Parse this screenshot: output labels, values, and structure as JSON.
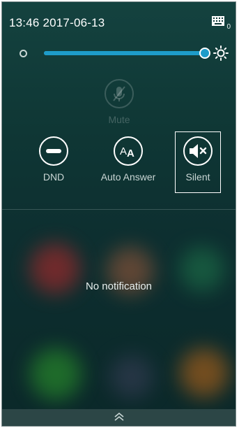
{
  "status_bar": {
    "time_date": "13:46 2017-06-13",
    "icon": "keyboard-icon",
    "badge": "0"
  },
  "brightness": {
    "level_percent": 98,
    "min_icon": "circle-outline-icon",
    "max_icon": "sun-icon"
  },
  "quick_toggles": {
    "mute": {
      "label": "Mute",
      "icon": "mic-off-icon",
      "enabled": false
    },
    "dnd": {
      "label": "DND",
      "icon": "minus-circle-icon",
      "active": false
    },
    "auto_answer": {
      "label": "Auto Answer",
      "icon": "aa-icon",
      "active": false
    },
    "silent": {
      "label": "Silent",
      "icon": "speaker-mute-icon",
      "selected": true
    }
  },
  "notifications": {
    "empty_text": "No notification"
  },
  "colors": {
    "accent": "#1e9cc9",
    "background": "#0f3735",
    "handle": "#2c4646"
  }
}
